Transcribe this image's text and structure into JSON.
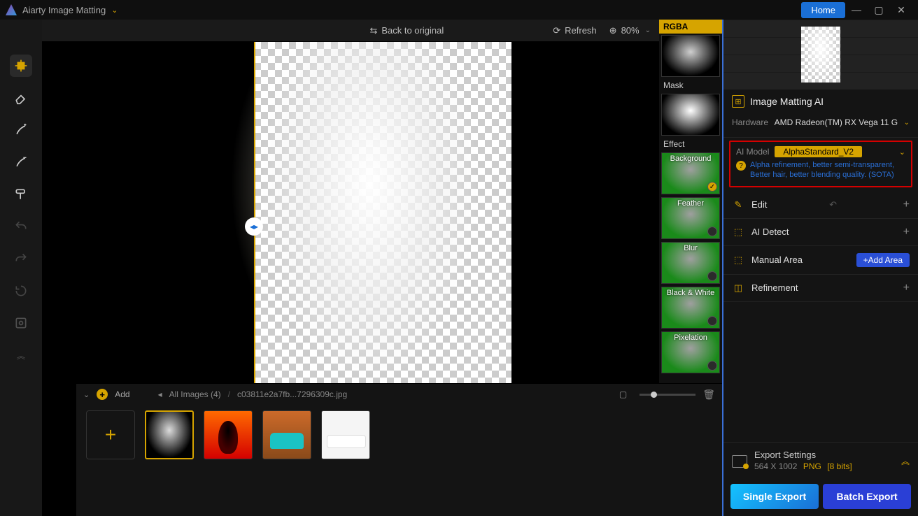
{
  "titlebar": {
    "app_name": "Aiarty Image Matting",
    "home_label": "Home"
  },
  "center_toolbar": {
    "back_label": "Back to original",
    "refresh_label": "Refresh",
    "zoom_value": "80%"
  },
  "preview_tabs": {
    "rgba": "RGBA",
    "mask": "Mask",
    "effect": "Effect"
  },
  "effects": [
    {
      "label": "Background",
      "selected": true
    },
    {
      "label": "Feather",
      "selected": false
    },
    {
      "label": "Blur",
      "selected": false
    },
    {
      "label": "Black & White",
      "selected": false
    },
    {
      "label": "Pixelation",
      "selected": false
    }
  ],
  "right": {
    "section_title": "Image Matting AI",
    "hardware_label": "Hardware",
    "hardware_value": "AMD Radeon(TM) RX Vega 11 G",
    "model_label": "AI Model",
    "model_value": "AlphaStandard_V2",
    "model_desc1": "Alpha refinement, better semi-transparent,",
    "model_desc2": "Better hair, better blending quality. (SOTA)",
    "edit_label": "Edit",
    "detect_label": "AI Detect",
    "manual_label": "Manual Area",
    "add_area_label": "+Add Area",
    "refine_label": "Refinement"
  },
  "export": {
    "title": "Export Settings",
    "dims": "564 X 1002",
    "format": "PNG",
    "bits": "[8 bits]",
    "single_label": "Single Export",
    "batch_label": "Batch Export"
  },
  "bottom": {
    "add_label": "Add",
    "crumb1": "All Images (4)",
    "crumb2": "c03811e2a7fb...7296309c.jpg"
  }
}
